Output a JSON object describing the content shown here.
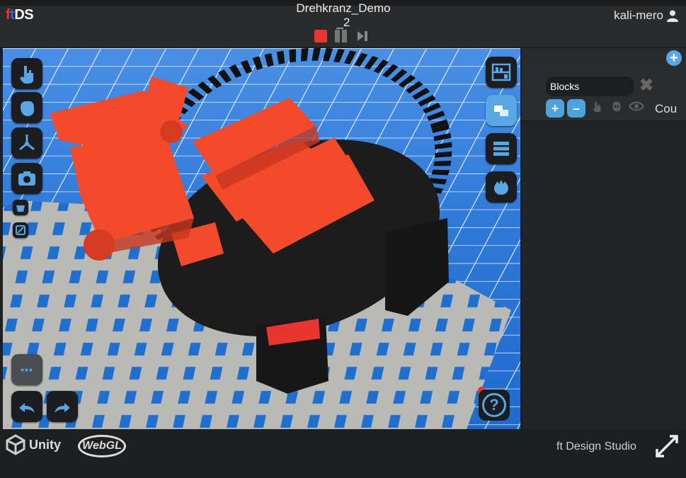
{
  "header": {
    "logo_f": "f",
    "logo_t": "t",
    "logo_ds": "DS",
    "project_title": "Drehkranz_Demo\n_2",
    "username": "kali-mero",
    "icons": {
      "user": "user-icon",
      "stop": "stop-icon",
      "pause": "pause-icon",
      "step": "step-forward-icon"
    }
  },
  "left_toolbar": [
    {
      "name": "pointer-tool",
      "icon": "hand-pointer-icon"
    },
    {
      "name": "grab-tool",
      "icon": "hand-grab-icon"
    },
    {
      "name": "move-tool",
      "icon": "axes-gizmo-icon"
    },
    {
      "name": "camera-tool",
      "icon": "camera-icon"
    },
    {
      "name": "basket-tool",
      "icon": "basket-icon"
    },
    {
      "name": "checkbox-tool",
      "icon": "checkbox-icon"
    }
  ],
  "right_toolbar": [
    {
      "name": "parts-catalog",
      "icon": "parts-shelf-icon"
    },
    {
      "name": "blocks-panel",
      "icon": "blocks-icon"
    },
    {
      "name": "list-view",
      "icon": "list-icon"
    },
    {
      "name": "water-view",
      "icon": "water-drop-icon"
    }
  ],
  "right_panel": {
    "add_label": "+",
    "block_name": "Blocks",
    "close_label": "✖",
    "add_block_label": "+",
    "remove_block_label": "–",
    "counter_label": "Cou",
    "icons": [
      "hand-icon",
      "robot-icon",
      "eye-icon"
    ]
  },
  "bottom_controls": {
    "more_label": "•••",
    "undo_icon": "undo-icon",
    "redo_icon": "redo-icon",
    "help_label": "?"
  },
  "footer": {
    "unity_label": "Unity",
    "webgl_label": "WebGL",
    "studio_label": "ft Design Studio",
    "fullscreen_icon": "fullscreen-icon"
  },
  "colors": {
    "accent_red": "#e8352e",
    "accent_blue": "#58a6e3",
    "toolbar_bg": "#1b1d21"
  }
}
